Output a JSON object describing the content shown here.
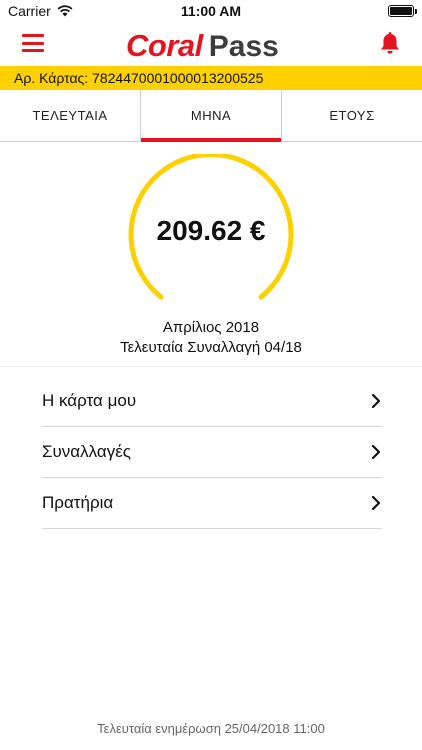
{
  "status_bar": {
    "carrier": "Carrier",
    "time": "11:00 AM"
  },
  "header": {
    "logo_part1": "Coral",
    "logo_part2": "Pass"
  },
  "card": {
    "label": "Αρ. Κάρτας: 7824470001000013200525"
  },
  "tabs": [
    {
      "label": "ΤΕΛΕΥΤΑΙΑ",
      "active": false
    },
    {
      "label": "ΜΗΝΑ",
      "active": true
    },
    {
      "label": "ΕΤΟΥΣ",
      "active": false
    }
  ],
  "summary": {
    "amount": "209.62 €",
    "period": "Απρίλιος 2018",
    "last_transaction": "Τελευταία Συναλλαγή 04/18"
  },
  "menu": [
    {
      "label": "Η κάρτα μου"
    },
    {
      "label": "Συναλλαγές"
    },
    {
      "label": "Πρατήρια"
    }
  ],
  "footer": {
    "last_update": "Τελευταία ενημέρωση 25/04/2018 11:00"
  },
  "colors": {
    "brand_red": "#e3141f",
    "accent_yellow": "#fdd000",
    "logo_gray": "#3d3d3d"
  }
}
